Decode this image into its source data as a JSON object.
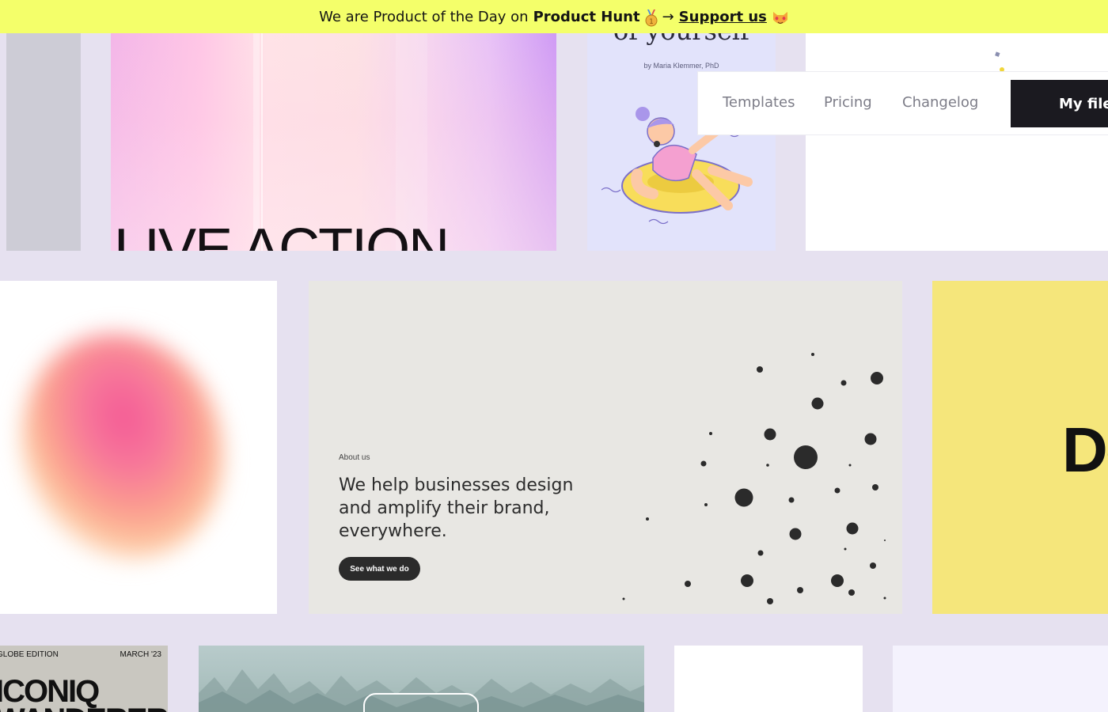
{
  "banner": {
    "prefix": "We are Product of the Day on",
    "product_hunt": "Product Hunt",
    "arrow": "→",
    "support_label": "Support us"
  },
  "nav": {
    "links": [
      "Templates",
      "Pricing",
      "Changelog"
    ],
    "cta_label": "My files"
  },
  "tiles": {
    "live_action": {
      "title": "LIVE ACTION"
    },
    "book": {
      "title": "of yourself",
      "author": "by Maria Klemmer, PhD"
    },
    "about": {
      "eyebrow": "About us",
      "headline": "We help businesses design and amplify their brand, everywhere.",
      "button": "See what we do"
    },
    "yellow": {
      "text": "De"
    },
    "iconiq": {
      "edition": "GLOBE EDITION",
      "date": "MARCH '23",
      "title_line1": "ICONIQ",
      "title_line2": "WANDERER"
    }
  },
  "colors": {
    "banner_bg": "#f4ff6a",
    "page_bg": "#e6e1f0",
    "cta_bg": "#1b1a20",
    "yellow_tile": "#f5e67b",
    "about_tile": "#e8e7e3"
  }
}
